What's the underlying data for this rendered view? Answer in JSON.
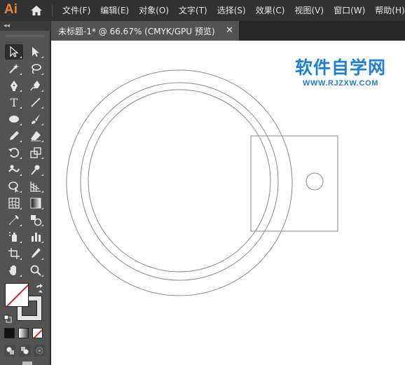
{
  "app": {
    "logo_text": "Ai",
    "accent_color": "#e9823b"
  },
  "menu": {
    "items": [
      {
        "label": "文件(F)"
      },
      {
        "label": "编辑(E)"
      },
      {
        "label": "对象(O)"
      },
      {
        "label": "文字(T)"
      },
      {
        "label": "选择(S)"
      },
      {
        "label": "效果(C)"
      },
      {
        "label": "视图(V)"
      },
      {
        "label": "窗口(W)"
      },
      {
        "label": "帮助(H)"
      }
    ]
  },
  "toolbar": {
    "collapse_glyph": "◂◂",
    "tools": [
      {
        "icon": "selection-icon"
      },
      {
        "icon": "direct-selection-icon"
      },
      {
        "icon": "magic-wand-icon"
      },
      {
        "icon": "lasso-icon"
      },
      {
        "icon": "pen-icon"
      },
      {
        "icon": "curvature-icon"
      },
      {
        "icon": "type-tool-icon",
        "glyph": "T"
      },
      {
        "icon": "line-segment-icon"
      },
      {
        "icon": "ellipse-icon"
      },
      {
        "icon": "paintbrush-icon"
      },
      {
        "icon": "pencil-icon"
      },
      {
        "icon": "eraser-icon"
      },
      {
        "icon": "rotate-icon"
      },
      {
        "icon": "scale-icon"
      },
      {
        "icon": "warp-icon"
      },
      {
        "icon": "puppet-warp-icon"
      },
      {
        "icon": "shape-builder-icon"
      },
      {
        "icon": "perspective-grid-icon"
      },
      {
        "icon": "mesh-icon"
      },
      {
        "icon": "gradient-icon"
      },
      {
        "icon": "eyedropper-icon"
      },
      {
        "icon": "blend-icon"
      },
      {
        "icon": "symbol-sprayer-icon"
      },
      {
        "icon": "column-graph-icon"
      },
      {
        "icon": "artboard-icon"
      },
      {
        "icon": "slice-icon"
      },
      {
        "icon": "hand-icon"
      },
      {
        "icon": "zoom-icon"
      }
    ],
    "fill_color": "#ffffff",
    "stroke_color": "#e6e6e6",
    "none_slash_color": "#e02020"
  },
  "document": {
    "tab_title": "未标题-1* @ 66.67% (CMYK/GPU 预览)",
    "close_glyph": "✕"
  },
  "watermark": {
    "title": "软件自学网",
    "url": "WWW.RJZXW.COM",
    "color": "#1e7fd6"
  },
  "artwork": {
    "stroke_color": "#8a8a8a"
  }
}
